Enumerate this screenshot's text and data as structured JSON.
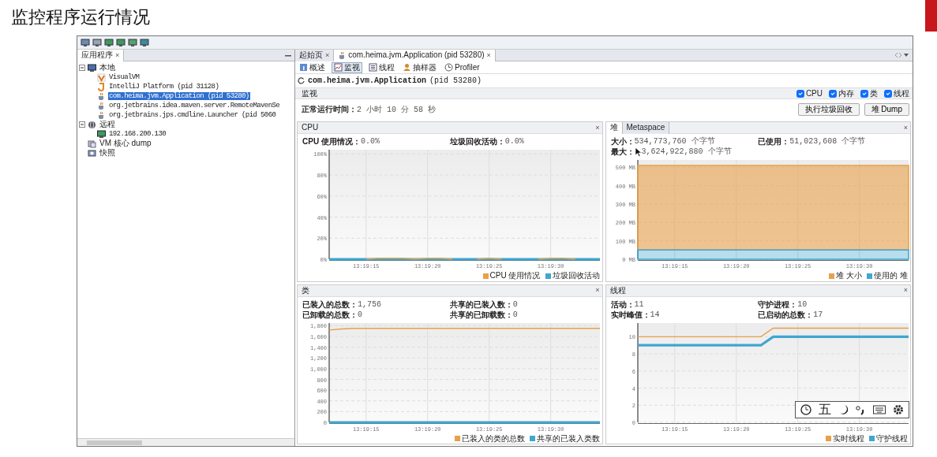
{
  "slide_title": "监控程序运行情况",
  "left_panel": {
    "tab": {
      "label": "应用程序",
      "close": "×"
    },
    "tree": [
      {
        "label": "本地",
        "kind": "local",
        "expanded": true,
        "selected": false,
        "children": [
          {
            "label": "VisualVM",
            "kind": "visualvm",
            "selected": false
          },
          {
            "label": "IntelliJ Platform (pid 31128)",
            "kind": "intellij",
            "selected": false
          },
          {
            "label": "com.heima.jvm.Application (pid 53280)",
            "kind": "java",
            "selected": true
          },
          {
            "label": "org.jetbrains.idea.maven.server.RemoteMavenSe",
            "kind": "java",
            "selected": false
          },
          {
            "label": "org.jetbrains.jps.cmdline.Launcher (pid 5060",
            "kind": "java",
            "selected": false
          }
        ]
      },
      {
        "label": "远程",
        "kind": "remote",
        "expanded": true,
        "selected": false,
        "children": [
          {
            "label": "192.168.200.130",
            "kind": "host",
            "selected": false
          }
        ]
      },
      {
        "label": "VM 核心 dump",
        "kind": "dump",
        "selected": false
      },
      {
        "label": "快照",
        "kind": "snapshot",
        "selected": false
      }
    ]
  },
  "main": {
    "tabs": [
      {
        "label": "起始页",
        "close": "×",
        "selected": false
      },
      {
        "label": "com.heima.jvm.Application (pid 53280)",
        "close": "×",
        "selected": true
      }
    ],
    "subtabs": [
      {
        "label": "概述",
        "selected": false
      },
      {
        "label": "监视",
        "selected": true
      },
      {
        "label": "线程",
        "selected": false
      },
      {
        "label": "抽样器",
        "selected": false
      },
      {
        "label": "Profiler",
        "selected": false
      }
    ],
    "app_name": "com.heima.jvm.Application",
    "pid": "(pid 53280)",
    "section": "监视",
    "toggles": [
      {
        "label": "CPU",
        "checked": true
      },
      {
        "label": "内存",
        "checked": true
      },
      {
        "label": "类",
        "checked": true
      },
      {
        "label": "线程",
        "checked": true
      }
    ],
    "uptime": {
      "label": "正常运行时间：",
      "value": "2 小时 10 分 58 秒"
    },
    "buttons": [
      "执行垃圾回收",
      "堆 Dump"
    ],
    "panels": [
      {
        "title": "CPU",
        "close": "×",
        "stats": [
          {
            "label": "CPU 使用情况：",
            "value": "0.0%"
          },
          {
            "label": "垃圾回收活动：",
            "value": "0.0%"
          }
        ],
        "chart_data": {
          "type": "line",
          "grid": true,
          "categories": [
            null,
            null,
            null,
            "13:19:15",
            null,
            null,
            null,
            null,
            "13:19:20",
            null,
            null,
            null,
            null,
            "13:19:25",
            null,
            null,
            null,
            null,
            "13:19:30",
            null,
            null,
            null,
            null
          ],
          "ylim": [
            0,
            104
          ],
          "yticks": [
            {
              "value": 0,
              "label": "0%"
            },
            {
              "value": 20,
              "label": "20%"
            },
            {
              "value": 40,
              "label": "40%"
            },
            {
              "value": 60,
              "label": "60%"
            },
            {
              "value": 80,
              "label": "80%"
            },
            {
              "value": 100,
              "label": "100%"
            }
          ],
          "series": [
            {
              "name": "CPU 使用情况",
              "color": "#e8a04a",
              "values": [
                null,
                null,
                null,
                0,
                1,
                1,
                1,
                0,
                1,
                1,
                0,
                null,
                0,
                1,
                0,
                null,
                null,
                0,
                1,
                1,
                0,
                null,
                null
              ]
            },
            {
              "name": "垃圾回收活动",
              "color": "#3fa6d0",
              "values": [
                0,
                0,
                0,
                0,
                0,
                0,
                0,
                0,
                0,
                0,
                0,
                0,
                0,
                0,
                0,
                0,
                0,
                0,
                0,
                0,
                0,
                0,
                0
              ]
            }
          ]
        }
      },
      {
        "tabs": [
          {
            "label": "堆",
            "selected": true
          },
          {
            "label": "Metaspace",
            "selected": false
          }
        ],
        "close": "×",
        "stats": [
          {
            "label": "大小：",
            "value": "534,773,760 个字节"
          },
          {
            "label": "已使用：",
            "value": "51,023,608 个字节"
          },
          {
            "label": "最大：",
            "value": "3,624,922,880 个字节",
            "pointer": true
          }
        ],
        "chart_data": {
          "type": "area",
          "grid": true,
          "categories": [
            null,
            null,
            null,
            "13:19:15",
            null,
            null,
            null,
            null,
            "13:19:20",
            null,
            null,
            null,
            null,
            "13:19:25",
            null,
            null,
            null,
            null,
            "13:19:30",
            null,
            null,
            null,
            null
          ],
          "ylim": [
            0,
            540
          ],
          "yticks": [
            {
              "value": 0,
              "label": "0 MB"
            },
            {
              "value": 100,
              "label": "100 MB"
            },
            {
              "value": 200,
              "label": "200 MB"
            },
            {
              "value": 300,
              "label": "300 MB"
            },
            {
              "value": 400,
              "label": "400 MB"
            },
            {
              "value": 500,
              "label": "500 MB"
            }
          ],
          "series": [
            {
              "name": "堆 大小",
              "color": "#e8a04a",
              "values": [
                510,
                510,
                510,
                510,
                510,
                510,
                510,
                510,
                510,
                510,
                510,
                510,
                510,
                510,
                510,
                510,
                510,
                510,
                510,
                510,
                510,
                510,
                510
              ]
            },
            {
              "name": "使用的 堆",
              "color": "#3fa6d0",
              "values": [
                50,
                50,
                50,
                50,
                50,
                50,
                50,
                50,
                50,
                50,
                50,
                50,
                50,
                50,
                50,
                50,
                50,
                50,
                50,
                50,
                50,
                50,
                50
              ]
            }
          ]
        }
      },
      {
        "title": "类",
        "close": "×",
        "stats": [
          {
            "label": "已装入的总数：",
            "value": "1,756"
          },
          {
            "label": "共享的已装入数：",
            "value": "0"
          },
          {
            "label": "已卸载的总数：",
            "value": "0"
          },
          {
            "label": "共享的已卸载数：",
            "value": "0"
          }
        ],
        "chart_data": {
          "type": "line",
          "grid": true,
          "categories": [
            null,
            null,
            null,
            "13:19:15",
            null,
            null,
            null,
            null,
            "13:19:20",
            null,
            null,
            null,
            null,
            "13:19:25",
            null,
            null,
            null,
            null,
            "13:19:30",
            null,
            null,
            null,
            null
          ],
          "ylim": [
            0,
            1850
          ],
          "yticks": [
            {
              "value": 0,
              "label": "0"
            },
            {
              "value": 200,
              "label": "200"
            },
            {
              "value": 400,
              "label": "400"
            },
            {
              "value": 600,
              "label": "600"
            },
            {
              "value": 800,
              "label": "800"
            },
            {
              "value": 1000,
              "label": "1,000"
            },
            {
              "value": 1200,
              "label": "1,200"
            },
            {
              "value": 1400,
              "label": "1,400"
            },
            {
              "value": 1600,
              "label": "1,600"
            },
            {
              "value": 1800,
              "label": "1,800"
            }
          ],
          "series": [
            {
              "name": "已装入的类的总数",
              "color": "#e8a04a",
              "values": [
                1720,
                1740,
                1750,
                1750,
                1750,
                1750,
                1750,
                1750,
                1750,
                1750,
                1750,
                1750,
                1750,
                1750,
                1750,
                1750,
                1750,
                1750,
                1750,
                1750,
                1750,
                1750,
                1750
              ]
            },
            {
              "name": "共享的已装入类数",
              "color": "#3fa6d0",
              "values": [
                0,
                0,
                0,
                0,
                0,
                0,
                0,
                0,
                0,
                0,
                0,
                0,
                0,
                0,
                0,
                0,
                0,
                0,
                0,
                0,
                0,
                0,
                0
              ]
            }
          ]
        }
      },
      {
        "title": "线程",
        "close": "×",
        "stats": [
          {
            "label": "活动：",
            "value": "11"
          },
          {
            "label": "守护进程：",
            "value": "10"
          },
          {
            "label": "实时峰值：",
            "value": "14"
          },
          {
            "label": "已启动的总数：",
            "value": "17"
          }
        ],
        "chart_data": {
          "type": "line",
          "grid": true,
          "categories": [
            null,
            null,
            null,
            "13:19:15",
            null,
            null,
            null,
            null,
            "13:19:20",
            null,
            null,
            null,
            null,
            "13:19:25",
            null,
            null,
            null,
            null,
            "13:19:30",
            null,
            null,
            null,
            null
          ],
          "ylim": [
            0,
            11.6
          ],
          "yticks": [
            0,
            2,
            4,
            6,
            8,
            10
          ],
          "series": [
            {
              "name": "实时线程",
              "color": "#e8a04a",
              "values": [
                10,
                10,
                10,
                10,
                10,
                10,
                10,
                10,
                10,
                10,
                10,
                11,
                11,
                11,
                11,
                11,
                11,
                11,
                11,
                11,
                11,
                11,
                11
              ]
            },
            {
              "name": "守护线程",
              "color": "#3fa6d0",
              "values": [
                9,
                9,
                9,
                9,
                9,
                9,
                9,
                9,
                9,
                9,
                9,
                10,
                10,
                10,
                10,
                10,
                10,
                10,
                10,
                10,
                10,
                10,
                10
              ]
            }
          ]
        },
        "ime_toolbar": {
          "label": "五"
        }
      }
    ]
  }
}
